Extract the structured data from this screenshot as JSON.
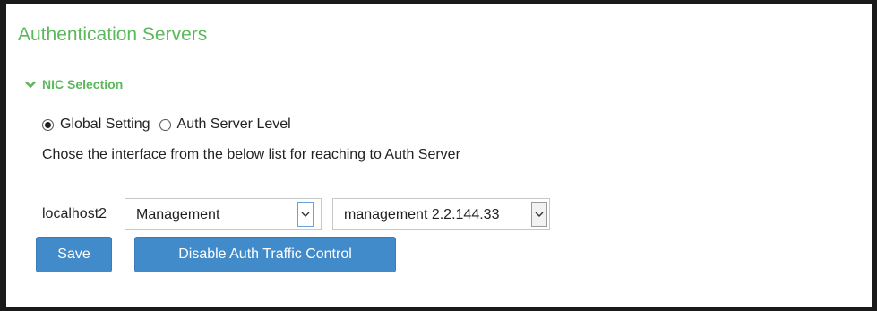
{
  "page": {
    "title": "Authentication Servers"
  },
  "section": {
    "header": "NIC Selection",
    "expanded": true
  },
  "radios": {
    "options": [
      {
        "label": "Global Setting",
        "checked": true
      },
      {
        "label": "Auth Server Level",
        "checked": false
      }
    ]
  },
  "instruction": "Chose the interface from the below list for reaching to Auth Server",
  "row": {
    "host": "localhost2",
    "interface_select": {
      "value": "Management"
    },
    "address_select": {
      "value": "management 2.2.144.33"
    }
  },
  "buttons": {
    "save": "Save",
    "disable": "Disable Auth Traffic Control"
  },
  "colors": {
    "title_green": "#5cb85c",
    "button_blue": "#428bca"
  },
  "icons": {
    "section_toggle": "chevron-down-icon",
    "select_arrow": "chevron-down-icon"
  }
}
